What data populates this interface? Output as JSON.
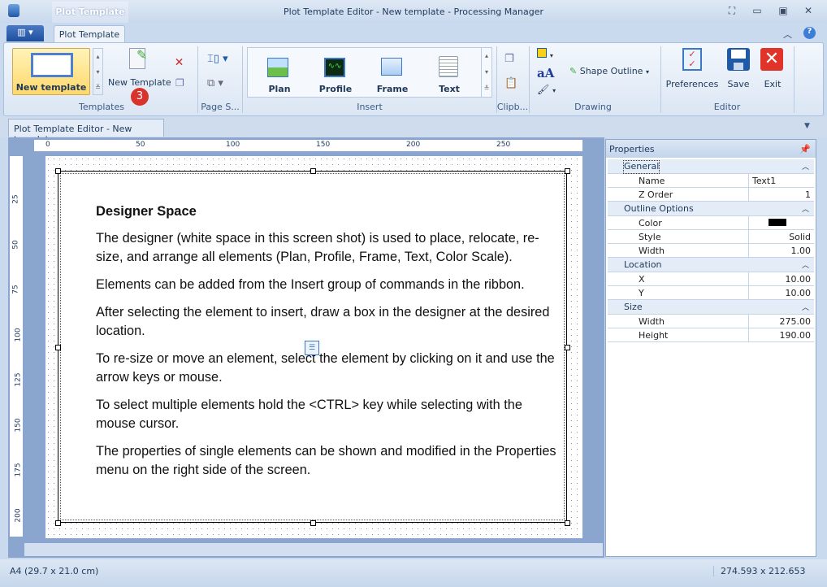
{
  "window": {
    "title": "Plot Template Editor - New template - Processing Manager",
    "context_tab": "Plot Template"
  },
  "ribbon": {
    "tab": "Plot Template",
    "groups": {
      "templates": "Templates",
      "page_setup": "Page S...",
      "insert": "Insert",
      "clipboard": "Clipb...",
      "drawing": "Drawing",
      "editor": "Editor"
    },
    "gallery_item": "New template",
    "new_template": "New Template",
    "badge": "3",
    "insert_items": [
      "Plan",
      "Profile",
      "Frame",
      "Text"
    ],
    "shape_outline": "Shape Outline",
    "preferences": "Preferences",
    "save": "Save",
    "exit": "Exit"
  },
  "document_tab": "Plot Template Editor - New template",
  "rulers": {
    "horizontal": [
      "0",
      "50",
      "100",
      "150",
      "200",
      "250"
    ],
    "vertical": [
      "25",
      "50",
      "75",
      "100",
      "125",
      "150",
      "175",
      "200"
    ]
  },
  "designer": {
    "heading": "Designer Space",
    "paragraphs": [
      "The designer (white space in this screen shot) is used to place, relocate, re-size, and arrange all elements (Plan, Profile, Frame, Text, Color Scale).",
      "Elements can be added from the Insert group of commands in the ribbon.",
      "After selecting the element to insert, draw a box in the designer at the desired location.",
      "To re-size or move an element, select the element by clicking on it and use the arrow keys or mouse.",
      "To select multiple elements hold the <CTRL> key while selecting with the mouse cursor.",
      "The properties of single elements can be shown and modified in the Properties menu on the right side of the screen."
    ]
  },
  "properties": {
    "title": "Properties",
    "categories": [
      {
        "name": "General",
        "rows": [
          {
            "name": "Name",
            "value": "Text1"
          },
          {
            "name": "Z Order",
            "value": "1"
          }
        ]
      },
      {
        "name": "Outline Options",
        "rows": [
          {
            "name": "Color",
            "value": "",
            "color": "#000000"
          },
          {
            "name": "Style",
            "value": "Solid"
          },
          {
            "name": "Width",
            "value": "1.00"
          }
        ]
      },
      {
        "name": "Location",
        "rows": [
          {
            "name": "X",
            "value": "10.00"
          },
          {
            "name": "Y",
            "value": "10.00"
          }
        ]
      },
      {
        "name": "Size",
        "rows": [
          {
            "name": "Width",
            "value": "275.00"
          },
          {
            "name": "Height",
            "value": "190.00"
          }
        ]
      }
    ]
  },
  "status": {
    "paper": "A4 (29.7 x 21.0 cm)",
    "coords": "274.593 x 212.653"
  }
}
